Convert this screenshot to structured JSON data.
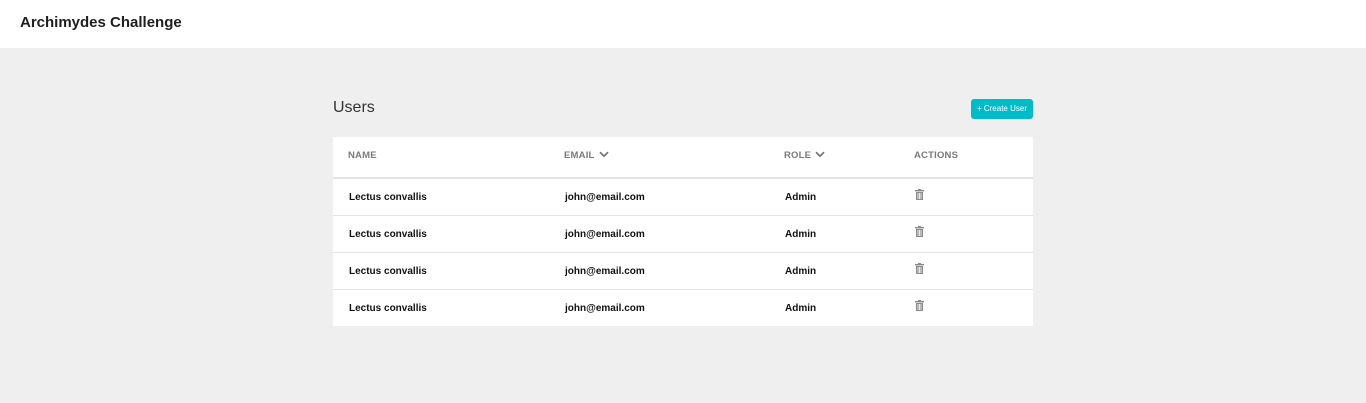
{
  "app": {
    "title": "Archimydes Challenge"
  },
  "page": {
    "title": "Users",
    "create_button": "+ Create User"
  },
  "table": {
    "headers": {
      "name": "NAME",
      "email": "EMAIL",
      "role": "ROLE",
      "actions": "ACTIONS"
    },
    "sortable_icon": "chevron-down-icon",
    "action_icon": "trash-icon",
    "rows": [
      {
        "name": "Lectus convallis",
        "email": "john@email.com",
        "role": "Admin"
      },
      {
        "name": "Lectus convallis",
        "email": "john@email.com",
        "role": "Admin"
      },
      {
        "name": "Lectus convallis",
        "email": "john@email.com",
        "role": "Admin"
      },
      {
        "name": "Lectus convallis",
        "email": "john@email.com",
        "role": "Admin"
      }
    ]
  },
  "colors": {
    "accent": "#00bcc8",
    "background": "#f0eff0",
    "surface": "#ffffff",
    "header_text": "#7a7a7a"
  }
}
